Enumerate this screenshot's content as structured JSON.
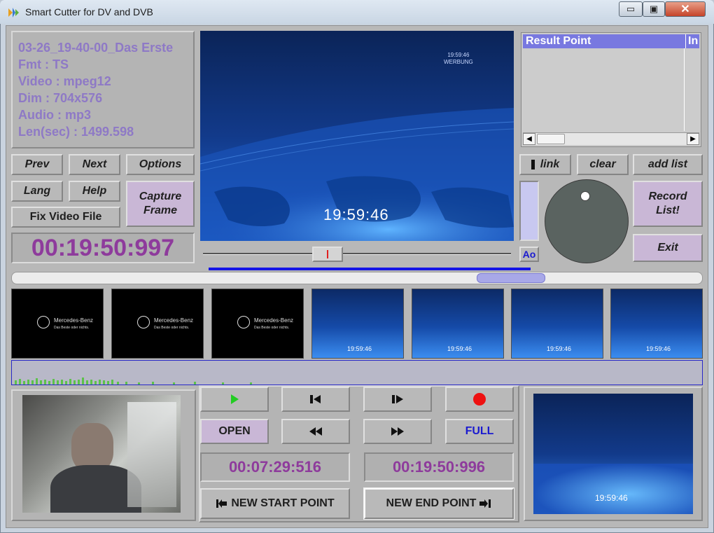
{
  "window": {
    "title": "Smart Cutter for DV and DVB",
    "minimize_label": "▭",
    "maximize_label": "▣",
    "close_label": "✕"
  },
  "info": {
    "lines": [
      "03-26_19-40-00_Das Erste",
      "Fmt : TS",
      "Video : mpeg12",
      "Dim : 704x576",
      "Audio : mp3",
      "Len(sec) : 1499.598"
    ]
  },
  "buttons": {
    "prev": "Prev",
    "next": "Next",
    "options": "Options",
    "lang": "Lang",
    "help": "Help",
    "capture_frame_line1": "Capture",
    "capture_frame_line2": "Frame",
    "fix_video_file": "Fix Video File",
    "link": "link",
    "clear": "clear",
    "add_list": "add list",
    "record_list_line1": "Record",
    "record_list_line2": "List!",
    "exit": "Exit",
    "ao": "Ao",
    "open": "OPEN",
    "full": "FULL",
    "new_start_point": "NEW START POINT",
    "new_end_point": "NEW END POINT"
  },
  "time": {
    "current": "00:19:50:997",
    "start_point": "00:07:29:516",
    "end_point": "00:19:50:996"
  },
  "video": {
    "overlay_time": "19:59:46",
    "corner_logo_line1": "19:59:46",
    "corner_logo_line2": "WERBUNG"
  },
  "result": {
    "header": "Result Point",
    "header_right": "In"
  },
  "thumbnails": [
    {
      "type": "mercedes",
      "caption_line1": "Mercedes-Benz",
      "caption_line2": "Das Beste oder nichts."
    },
    {
      "type": "mercedes",
      "caption_line1": "Mercedes-Benz",
      "caption_line2": "Das Beste oder nichts."
    },
    {
      "type": "mercedes",
      "caption_line1": "Mercedes-Benz",
      "caption_line2": "Das Beste oder nichts."
    },
    {
      "type": "globe",
      "caption_line1": "19:59:46"
    },
    {
      "type": "globe",
      "caption_line1": "19:59:46"
    },
    {
      "type": "globe",
      "caption_line1": "19:59:46"
    },
    {
      "type": "globe",
      "caption_line1": "19:59:46"
    }
  ],
  "preview": {
    "overlay_time": "19:59:46"
  },
  "colors": {
    "accent_purple": "#8e3b9c",
    "info_text": "#8e79c6",
    "header_blue": "#7878e0",
    "record_red": "#ee1111",
    "play_green": "#22cc22",
    "full_blue": "#1a1ad0"
  },
  "timeline": {
    "position_fraction": 0.385
  }
}
